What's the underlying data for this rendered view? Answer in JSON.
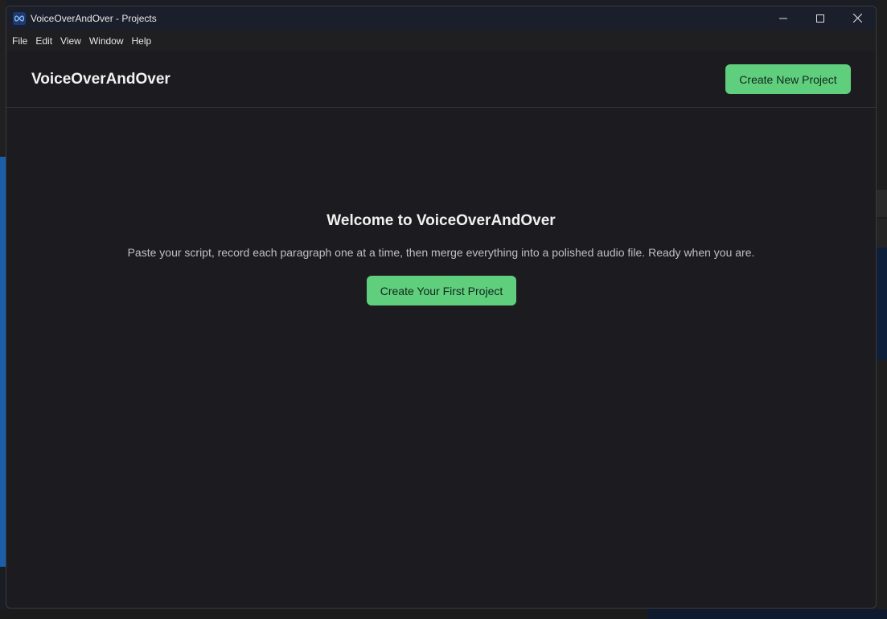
{
  "window": {
    "title": "VoiceOverAndOver - Projects"
  },
  "menu": {
    "items": [
      "File",
      "Edit",
      "View",
      "Window",
      "Help"
    ]
  },
  "header": {
    "brand": "VoiceOverAndOver",
    "create_button": "Create New Project"
  },
  "main": {
    "welcome_title": "Welcome to VoiceOverAndOver",
    "welcome_description": "Paste your script, record each paragraph one at a time, then merge everything into a polished audio file. Ready when you are.",
    "first_project_button": "Create Your First Project"
  },
  "colors": {
    "accent": "#5fcf7e",
    "background": "#1c1c20",
    "titlebar": "#1a1f2b"
  },
  "icons": {
    "app": "infinity-icon",
    "minimize": "minimize-icon",
    "maximize": "maximize-icon",
    "close": "close-icon"
  }
}
